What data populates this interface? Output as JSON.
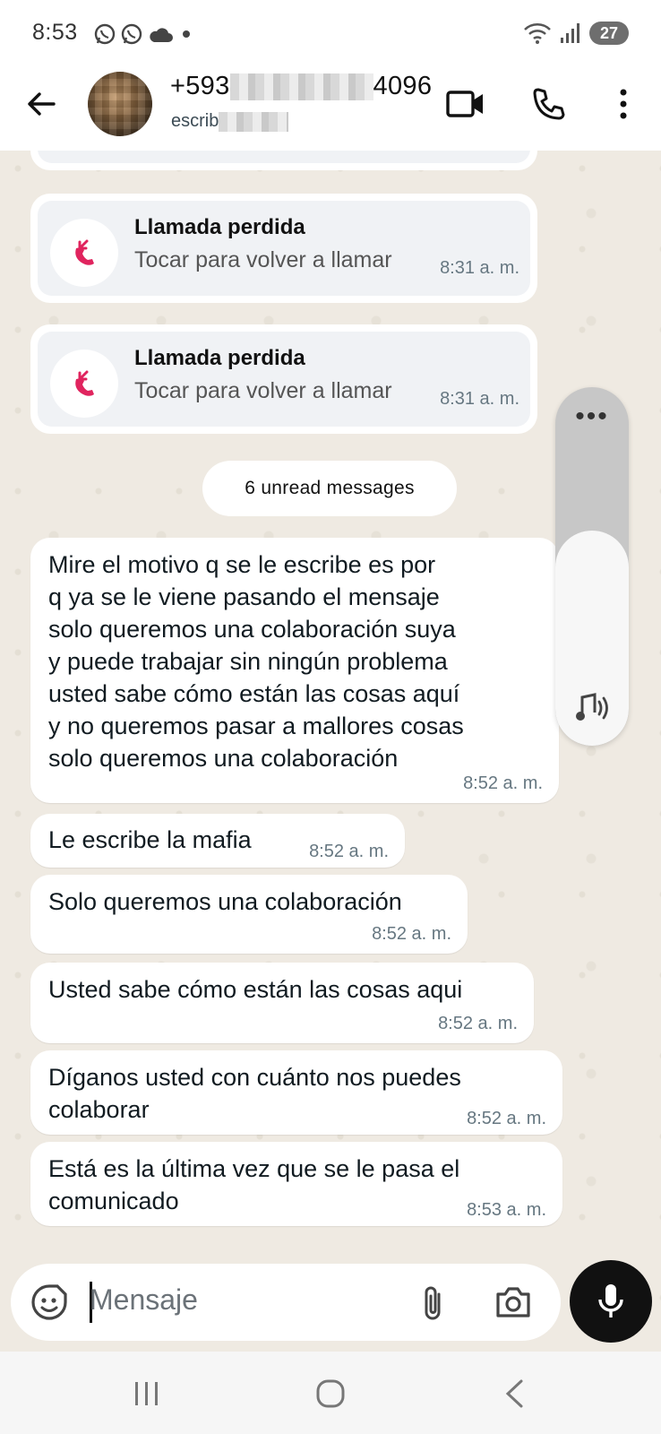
{
  "status_bar": {
    "time": "8:53",
    "battery": "27",
    "icons_left": [
      "whatsapp-icon",
      "whatsapp-icon",
      "cloud-icon",
      "dot-icon"
    ],
    "icons_right": [
      "wifi-icon",
      "signal-icon",
      "battery-icon"
    ]
  },
  "header": {
    "contact_prefix": "+593",
    "contact_suffix": "4096",
    "status_prefix": "escrib",
    "icons": [
      "back-arrow-icon",
      "video-call-icon",
      "phone-icon",
      "more-vert-icon"
    ]
  },
  "calls": [
    {
      "title": "Llamada perdida",
      "subtitle": "Tocar para volver a llamar",
      "time": "8:31 a. m."
    },
    {
      "title": "Llamada perdida",
      "subtitle": "Tocar para volver a llamar",
      "time": "8:31 a. m."
    }
  ],
  "unread_label": "6 unread messages",
  "messages": [
    {
      "text": "Mire el motivo q se le escribe es por\nq ya se le viene pasando el mensaje\nsolo queremos una colaboración suya\ny puede trabajar sin ningún problema\nusted sabe cómo están las cosas aquí\ny no queremos pasar a mallores cosas\nsolo queremos una colaboración",
      "time": "8:52 a. m."
    },
    {
      "text": "Le escribe la mafia",
      "time": "8:52 a. m."
    },
    {
      "text": "Solo queremos una colaboración",
      "time": "8:52 a. m."
    },
    {
      "text": "Usted sabe cómo están las cosas aqui",
      "time": "8:52 a. m."
    },
    {
      "text": "Díganos usted con cuánto nos puedes\ncolaborar",
      "time": "8:52 a. m."
    },
    {
      "text": "Está es la última vez que se le pasa el\ncomunicado",
      "time": "8:53 a. m."
    }
  ],
  "volume": {
    "level": 0.6,
    "more_label": "•••"
  },
  "input": {
    "placeholder": "Mensaje"
  },
  "nav": [
    "recents-icon",
    "home-icon",
    "back-icon"
  ],
  "colors": {
    "chat_bg": "#efeae2",
    "missed_call": "#e0245e",
    "bubble": "#ffffff",
    "mic_button": "#111111"
  }
}
